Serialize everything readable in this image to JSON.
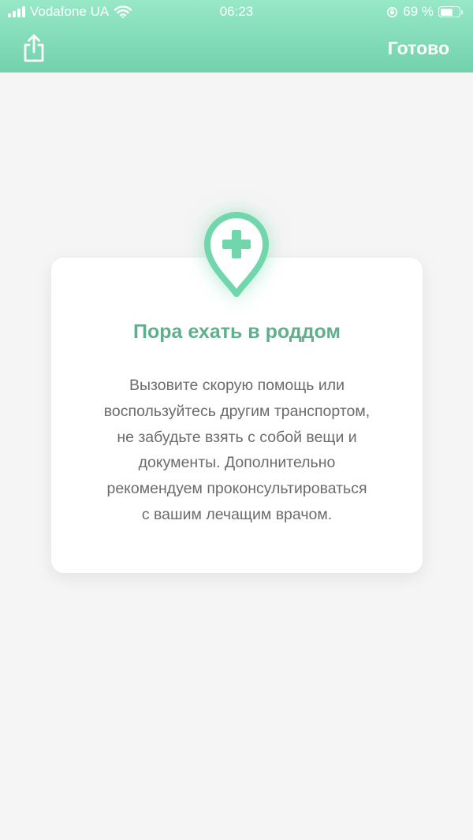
{
  "status_bar": {
    "carrier": "Vodafone UA",
    "time": "06:23",
    "battery_percent": "69 %",
    "battery_level": 0.69
  },
  "header": {
    "share_icon": "share-icon",
    "done_label": "Готово",
    "accent_color": "#7fdcb8"
  },
  "card": {
    "icon": "medical-location-pin-icon",
    "title": "Пора ехать в роддом",
    "body_lines": [
      "Вызовите скорую помощь или",
      "воспользуйтесь другим транспортом,",
      "не забудьте взять с собой вещи и",
      "документы. Дополнительно",
      "рекомендуем проконсультироваться",
      "с вашим лечащим врачом."
    ],
    "title_color": "#5fae8c",
    "icon_color": "#72d6ad"
  }
}
